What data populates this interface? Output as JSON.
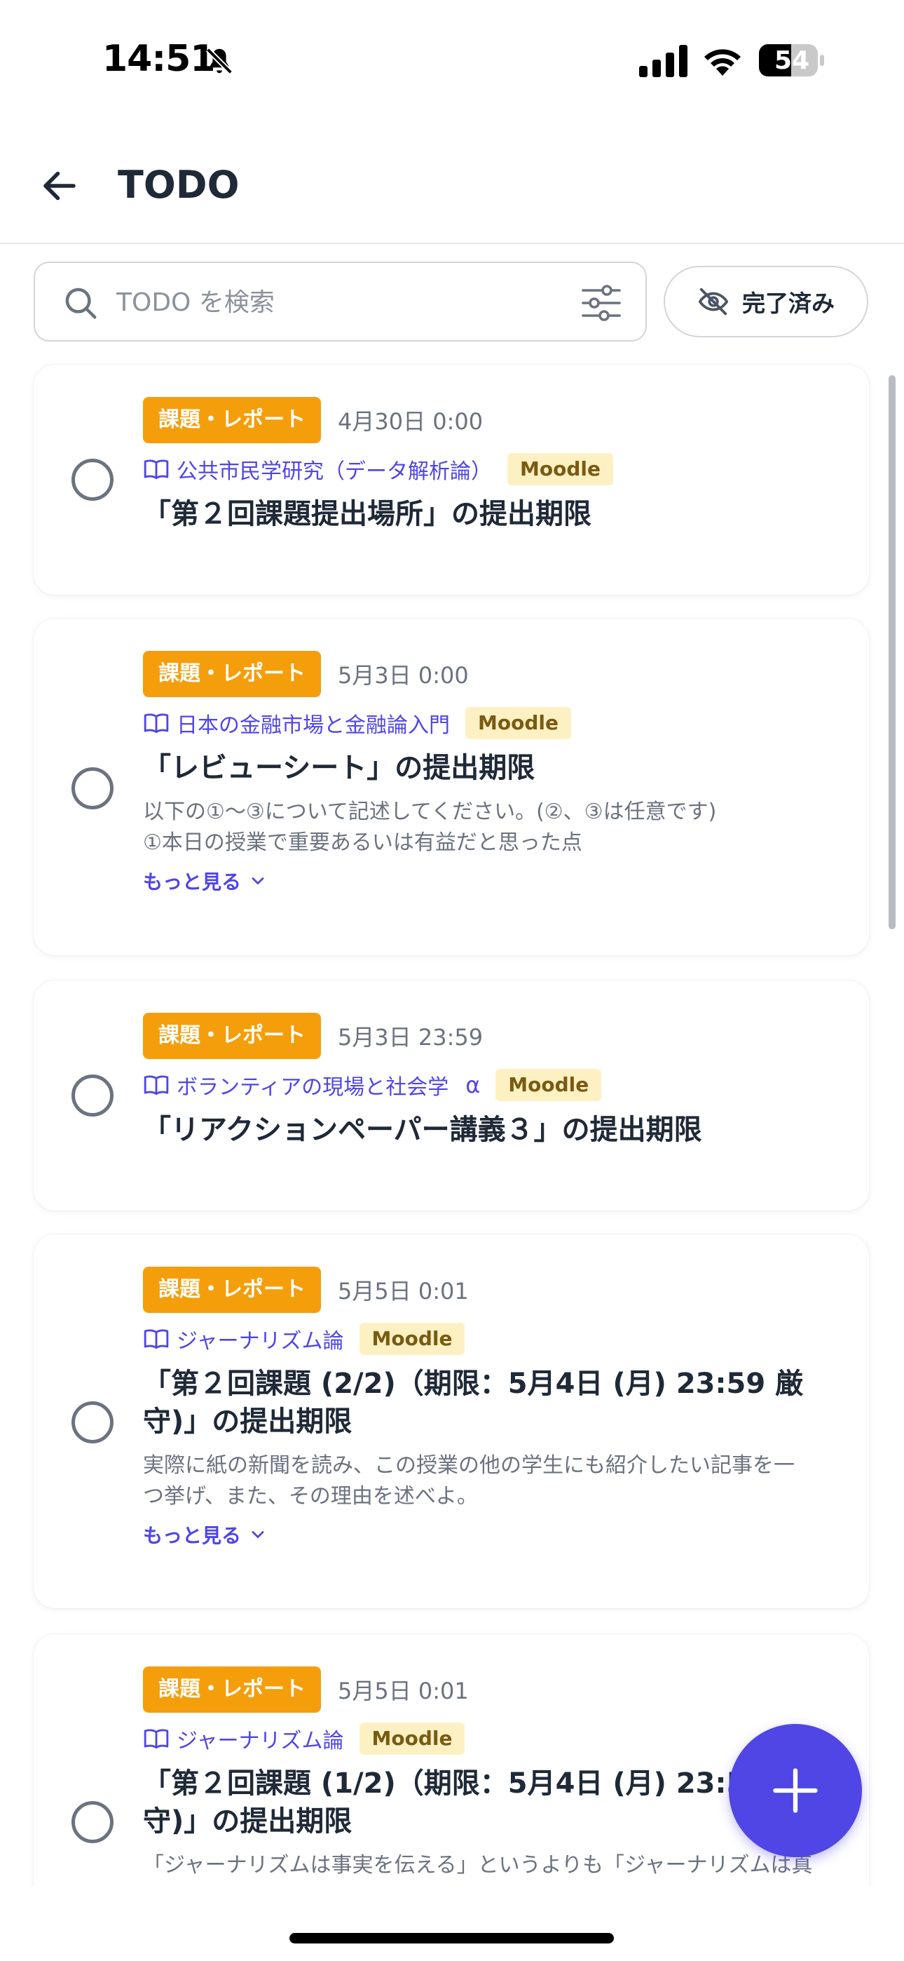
{
  "status_bar": {
    "time": "14:51",
    "battery": "54"
  },
  "header": {
    "title": "TODO"
  },
  "search": {
    "placeholder": "TODO を検索",
    "value": ""
  },
  "toggle": {
    "label": "完了済み"
  },
  "items": [
    {
      "tag": "課題・レポート",
      "due": "4月30日 0:00",
      "course": "公共市民学研究（データ解析論）",
      "source": "Moodle",
      "title": "「第２回課題提出場所」の提出期限"
    },
    {
      "tag": "課題・レポート",
      "due": "5月3日 0:00",
      "course": "日本の金融市場と金融論入門",
      "source": "Moodle",
      "title": "「レビューシート」の提出期限",
      "description_line1": "以下の①～③について記述してください。(②、③は任意です)",
      "description_line2": "①本日の授業で重要あるいは有益だと思った点",
      "more": "もっと見る"
    },
    {
      "tag": "課題・レポート",
      "due": "5月3日 23:59",
      "course": "ボランティアの現場と社会学",
      "course_suffix": "α",
      "source": "Moodle",
      "title": "「リアクションペーパー講義３」の提出期限"
    },
    {
      "tag": "課題・レポート",
      "due": "5月5日 0:01",
      "course": "ジャーナリズム論",
      "source": "Moodle",
      "title_line1": "「第２回課題 (2/2)（期限：5月4日 (月) 23:59 厳",
      "title_line2": "守)」の提出期限",
      "description_line1": "実際に紙の新聞を読み、この授業の他の学生にも紹介したい記事を一",
      "description_line2": "つ挙げ、また、その理由を述べよ。",
      "more": "もっと見る"
    },
    {
      "tag": "課題・レポート",
      "due": "5月5日 0:01",
      "course": "ジャーナリズム論",
      "source": "Moodle",
      "title_line1": "「第２回課題 (1/2)（期限：5月4日 (月) 23:59 厳",
      "title_line2": "守)」の提出期限",
      "description_line1": "「ジャーナリズムは事実を伝える」というよりも「ジャーナリズムは真"
    }
  ],
  "colors": {
    "accent": "#4f46e5",
    "tag": "#f59e0b",
    "source_badge_bg": "#fdf1c4"
  },
  "icons": {
    "back": "arrow-left-icon",
    "search": "search-icon",
    "filter": "sliders-icon",
    "hidden": "eye-off-icon",
    "course": "book-open-icon",
    "more": "chevron-down-icon",
    "fab": "plus-icon"
  }
}
